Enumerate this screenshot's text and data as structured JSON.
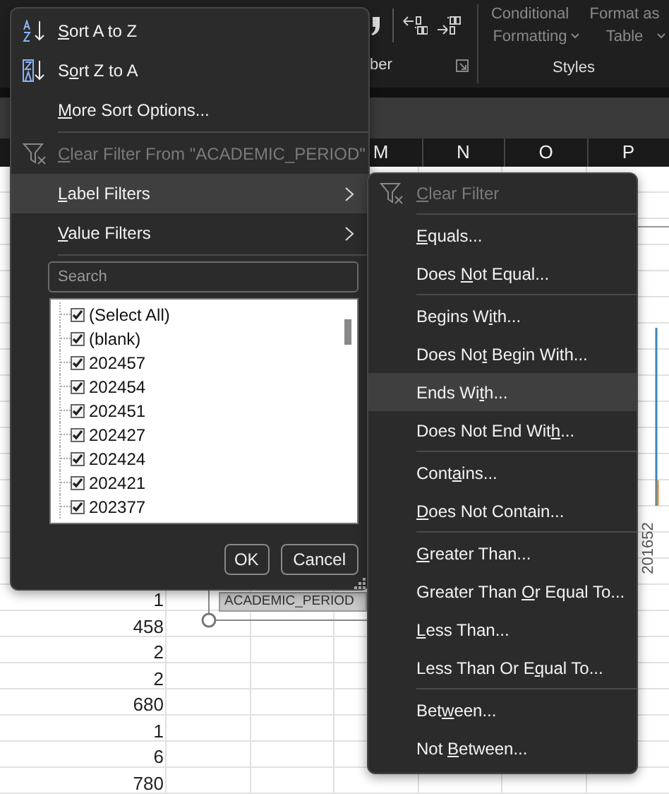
{
  "ribbon": {
    "number_group": {
      "label": "ber"
    },
    "styles_group": {
      "buttons": [
        {
          "label": "Conditional Formatting",
          "disabled": true
        },
        {
          "label": "Format as Table",
          "disabled": true
        }
      ],
      "label": "Styles"
    }
  },
  "column_headers": [
    "M",
    "N",
    "O",
    "P"
  ],
  "row_values": [
    "1",
    "458",
    "2",
    "2",
    "680",
    "1",
    "6",
    "780"
  ],
  "chart": {
    "field_button": "ACADEMIC_PERIOD",
    "axis_labels": [
      "201652"
    ]
  },
  "filter_menu": {
    "items": [
      {
        "kind": "sort-ascending",
        "access_key": "S",
        "label_end": "ort A to Z",
        "disabled": false,
        "highlighted": false
      },
      {
        "kind": "sort-descending",
        "label_start": "S",
        "access_key": "o",
        "label_end": "rt Z to A",
        "disabled": false,
        "highlighted": false
      },
      {
        "kind": "command",
        "access_key": "M",
        "label_end": "ore Sort Options...",
        "disabled": false,
        "highlighted": false
      },
      {
        "kind": "separator"
      },
      {
        "kind": "clear-filter",
        "access_key": "C",
        "label_end": "lear Filter From \"ACADEMIC_PERIOD\"",
        "disabled": true,
        "highlighted": false
      },
      {
        "kind": "submenu",
        "access_key": "L",
        "label_end": "abel Filters",
        "disabled": false,
        "highlighted": true
      },
      {
        "kind": "submenu",
        "access_key": "V",
        "label_end": "alue Filters",
        "disabled": false,
        "highlighted": false
      },
      {
        "kind": "separator"
      }
    ],
    "search": {
      "placeholder": "Search"
    },
    "values": [
      {
        "label": "(Select All)",
        "checked": true
      },
      {
        "label": "(blank)",
        "checked": true
      },
      {
        "label": "202457",
        "checked": true
      },
      {
        "label": "202454",
        "checked": true
      },
      {
        "label": "202451",
        "checked": true
      },
      {
        "label": "202427",
        "checked": true
      },
      {
        "label": "202424",
        "checked": true
      },
      {
        "label": "202421",
        "checked": true
      },
      {
        "label": "202377",
        "checked": true
      }
    ],
    "buttons": [
      "OK",
      "Cancel"
    ]
  },
  "label_filters_menu": {
    "items": [
      {
        "kind": "clear-filter",
        "access_key": "C",
        "label_end": "lear Filter",
        "disabled": true,
        "highlighted": false
      },
      {
        "kind": "separator"
      },
      {
        "kind": "command",
        "access_key": "E",
        "label_end": "quals...",
        "disabled": false,
        "highlighted": false
      },
      {
        "kind": "command",
        "label_start": "Does ",
        "access_key": "N",
        "label_end": "ot Equal...",
        "disabled": false,
        "highlighted": false
      },
      {
        "kind": "separator"
      },
      {
        "kind": "command",
        "label_start": "Begins W",
        "access_key": "i",
        "label_end": "th...",
        "disabled": false,
        "highlighted": false
      },
      {
        "kind": "command",
        "label_start": "Does No",
        "access_key": "t",
        "label_end": " Begin With...",
        "disabled": false,
        "highlighted": false
      },
      {
        "kind": "command",
        "label_start": "Ends Wi",
        "access_key": "t",
        "label_end": "h...",
        "disabled": false,
        "highlighted": true
      },
      {
        "kind": "command",
        "label_start": "Does Not End Wit",
        "access_key": "h",
        "label_end": "...",
        "disabled": false,
        "highlighted": false
      },
      {
        "kind": "separator"
      },
      {
        "kind": "command",
        "label_start": "Cont",
        "access_key": "a",
        "label_end": "ins...",
        "disabled": false,
        "highlighted": false
      },
      {
        "kind": "command",
        "access_key": "D",
        "label_end": "oes Not Contain...",
        "disabled": false,
        "highlighted": false
      },
      {
        "kind": "separator"
      },
      {
        "kind": "command",
        "access_key": "G",
        "label_end": "reater Than...",
        "disabled": false,
        "highlighted": false
      },
      {
        "kind": "command",
        "label_start": "Greater Than ",
        "access_key": "O",
        "label_end": "r Equal To...",
        "disabled": false,
        "highlighted": false
      },
      {
        "kind": "command",
        "access_key": "L",
        "label_end": "ess Than...",
        "disabled": false,
        "highlighted": false
      },
      {
        "kind": "command",
        "label_start": "Less Than Or E",
        "access_key": "q",
        "label_end": "ual To...",
        "disabled": false,
        "highlighted": false
      },
      {
        "kind": "separator"
      },
      {
        "kind": "command",
        "label_start": "Bet",
        "access_key": "w",
        "label_end": "een...",
        "disabled": false,
        "highlighted": false
      },
      {
        "kind": "command",
        "label_start": "Not ",
        "access_key": "B",
        "label_end": "etween...",
        "disabled": false,
        "highlighted": false
      }
    ]
  }
}
